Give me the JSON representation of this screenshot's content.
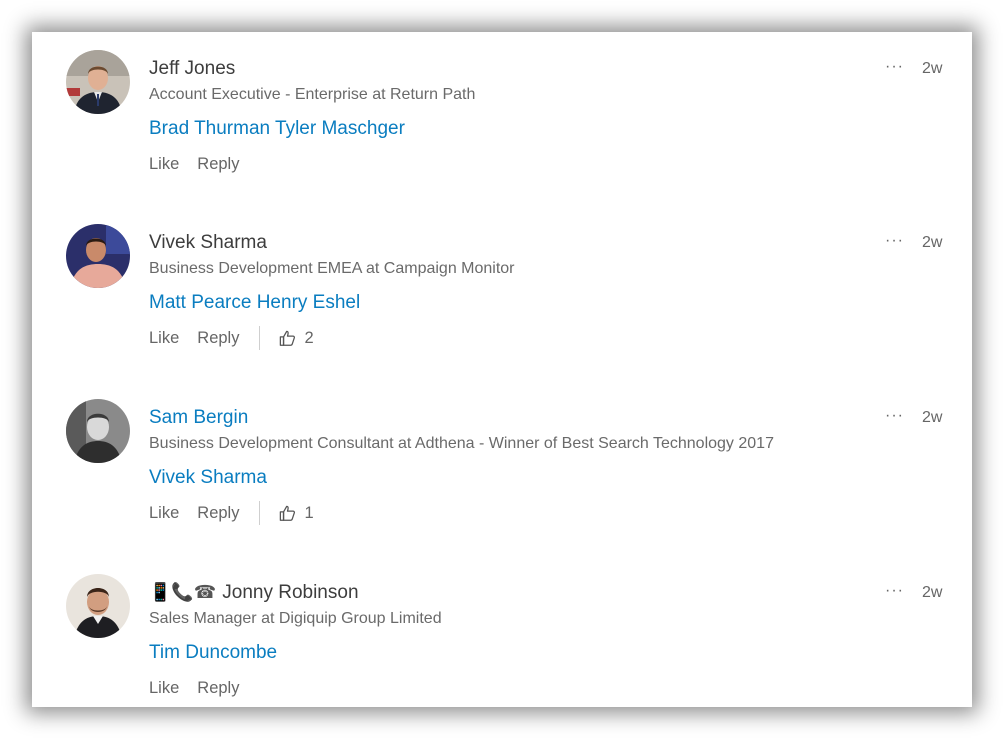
{
  "comments": [
    {
      "name": "Jeff Jones",
      "headline": "Account Executive - Enterprise at Return Path",
      "mention": "Brad Thurman Tyler Maschger",
      "like_label": "Like",
      "reply_label": "Reply",
      "time": "2w",
      "avatar_icon": "avatar-photo"
    },
    {
      "name": "Vivek Sharma",
      "headline": "Business Development EMEA at Campaign Monitor",
      "mention": "Matt Pearce Henry Eshel",
      "like_label": "Like",
      "reply_label": "Reply",
      "likes_count": "2",
      "time": "2w",
      "avatar_icon": "avatar-photo"
    },
    {
      "name": "Sam Bergin",
      "headline": "Business Development Consultant at Adthena - Winner of Best Search Technology 2017",
      "mention": "Vivek Sharma",
      "like_label": "Like",
      "reply_label": "Reply",
      "likes_count": "1",
      "time": "2w",
      "avatar_icon": "avatar-photo"
    },
    {
      "name_prefix": "📱📞☎",
      "name": "Jonny Robinson",
      "headline": "Sales Manager at Digiquip Group Limited",
      "mention": "Tim Duncombe",
      "like_label": "Like",
      "reply_label": "Reply",
      "time": "2w",
      "avatar_icon": "avatar-photo"
    }
  ],
  "more_label": "···",
  "colors": {
    "name": "#3d3d3d",
    "link": "#0a7dc0",
    "secondary": "#6a6a6a"
  }
}
